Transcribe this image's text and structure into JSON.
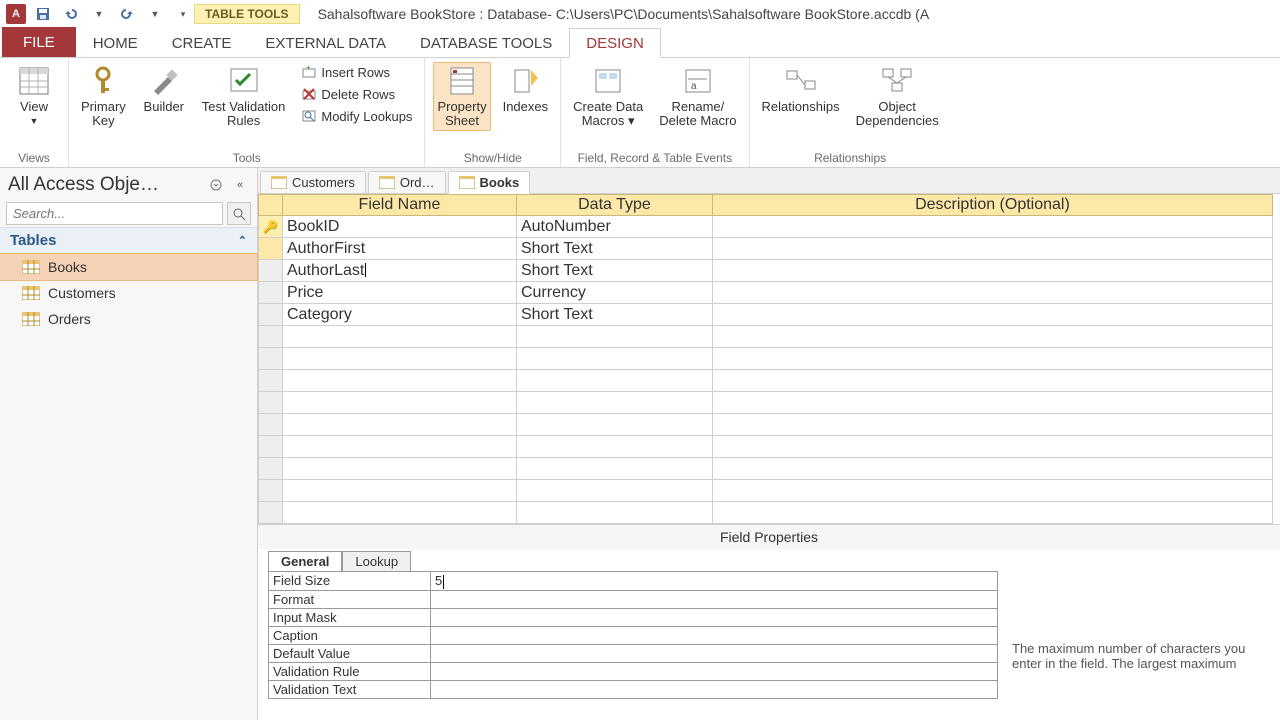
{
  "titlebar": {
    "contextual_label": "TABLE TOOLS",
    "window_title": "Sahalsoftware BookStore : Database- C:\\Users\\PC\\Documents\\Sahalsoftware BookStore.accdb (A"
  },
  "tabs": {
    "file": "FILE",
    "home": "HOME",
    "create": "CREATE",
    "external": "EXTERNAL DATA",
    "dbtools": "DATABASE TOOLS",
    "design": "DESIGN"
  },
  "ribbon": {
    "views": {
      "view": "View",
      "group": "Views"
    },
    "tools": {
      "primary_key": "Primary\nKey",
      "builder": "Builder",
      "test_validation": "Test Validation\nRules",
      "insert_rows": "Insert Rows",
      "delete_rows": "Delete Rows",
      "modify_lookups": "Modify Lookups",
      "group": "Tools"
    },
    "showhide": {
      "property_sheet": "Property\nSheet",
      "indexes": "Indexes",
      "group": "Show/Hide"
    },
    "events": {
      "create_macros": "Create Data\nMacros ▾",
      "rename_delete": "Rename/\nDelete Macro",
      "group": "Field, Record & Table Events"
    },
    "rel": {
      "relationships": "Relationships",
      "dependencies": "Object\nDependencies",
      "group": "Relationships"
    }
  },
  "nav": {
    "title": "All Access Obje…",
    "search_placeholder": "Search...",
    "group_tables": "Tables",
    "items": [
      "Books",
      "Customers",
      "Orders"
    ]
  },
  "doctabs": [
    "Customers",
    "Ord…",
    "Books"
  ],
  "grid": {
    "headers": {
      "field": "Field Name",
      "type": "Data Type",
      "desc": "Description (Optional)"
    },
    "rows": [
      {
        "field": "BookID",
        "type": "AutoNumber",
        "pk": true
      },
      {
        "field": "AuthorFirst",
        "type": "Short Text",
        "sel": true
      },
      {
        "field": "AuthorLast",
        "type": "Short Text"
      },
      {
        "field": "Price",
        "type": "Currency"
      },
      {
        "field": "Category",
        "type": "Short Text"
      }
    ]
  },
  "field_props": {
    "title": "Field Properties",
    "tabs": {
      "general": "General",
      "lookup": "Lookup"
    },
    "rows": [
      {
        "k": "Field Size",
        "v": "5"
      },
      {
        "k": "Format",
        "v": ""
      },
      {
        "k": "Input Mask",
        "v": ""
      },
      {
        "k": "Caption",
        "v": ""
      },
      {
        "k": "Default Value",
        "v": ""
      },
      {
        "k": "Validation Rule",
        "v": ""
      },
      {
        "k": "Validation Text",
        "v": ""
      }
    ],
    "help": "The maximum number of characters you enter in the field. The largest maximum"
  }
}
